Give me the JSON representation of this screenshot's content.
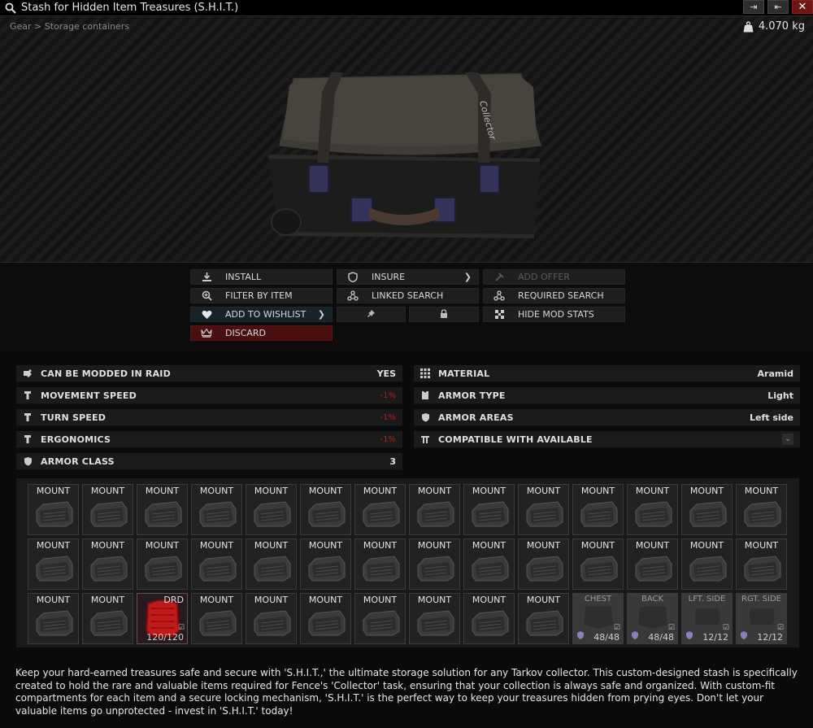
{
  "window": {
    "title": "Stash for Hidden Item Treasures (S.H.I.T.)",
    "buttons": [
      "⇥",
      "⇤",
      "✕"
    ]
  },
  "header": {
    "breadcrumb": "Gear > Storage containers",
    "weight": "4.070 kg"
  },
  "image": {
    "case_text": "Collector"
  },
  "actions": {
    "install": "INSTALL",
    "insure": "INSURE",
    "add_offer": "ADD OFFER",
    "filter_by_item": "FILTER BY ITEM",
    "linked_search": "LINKED SEARCH",
    "required_search": "REQUIRED SEARCH",
    "add_to_wishlist": "ADD TO WISHLIST",
    "hide_mod_stats": "HIDE MOD STATS",
    "discard": "DISCARD"
  },
  "stats_left": [
    {
      "name": "CAN BE MODDED IN RAID",
      "value": "YES"
    },
    {
      "name": "MOVEMENT SPEED",
      "value": "-1%"
    },
    {
      "name": "TURN SPEED",
      "value": "-1%"
    },
    {
      "name": "ERGONOMICS",
      "value": "-1%"
    },
    {
      "name": "ARMOR CLASS",
      "value": "3"
    }
  ],
  "stats_right": [
    {
      "name": "MATERIAL",
      "value": "Aramid"
    },
    {
      "name": "ARMOR TYPE",
      "value": "Light"
    },
    {
      "name": "ARMOR AREAS",
      "value": "Left side"
    },
    {
      "name": "COMPATIBLE WITH AVAILABLE",
      "value": ""
    }
  ],
  "slots": {
    "mount_label": "MOUNT",
    "drd": {
      "label": "DRD",
      "durability": "120/120"
    },
    "armor": [
      {
        "label": "CHEST",
        "durability": "48/48"
      },
      {
        "label": "BACK",
        "durability": "48/48"
      },
      {
        "label": "LFT. SIDE",
        "durability": "12/12"
      },
      {
        "label": "RGT. SIDE",
        "durability": "12/12"
      }
    ]
  },
  "description": "Keep your hard-earned treasures safe and secure with 'S.H.I.T.,' the ultimate storage solution for any Tarkov collector. This custom-designed stash is specifically created to hold the rare and valuable items required for Fence's 'Collector' task, ensuring that your collection is always safe and organized. With custom-fit compartments for each item and a secure locking mechanism, 'S.H.I.T.' is the perfect way to keep your treasures hidden from prying eyes. Don't let your valuable items go unprotected - invest in 'S.H.I.T.' today!",
  "colors": {
    "negative": "#b71c1c",
    "discard_bg": "#4a0f0f",
    "wishlist_bg": "#16232b"
  }
}
